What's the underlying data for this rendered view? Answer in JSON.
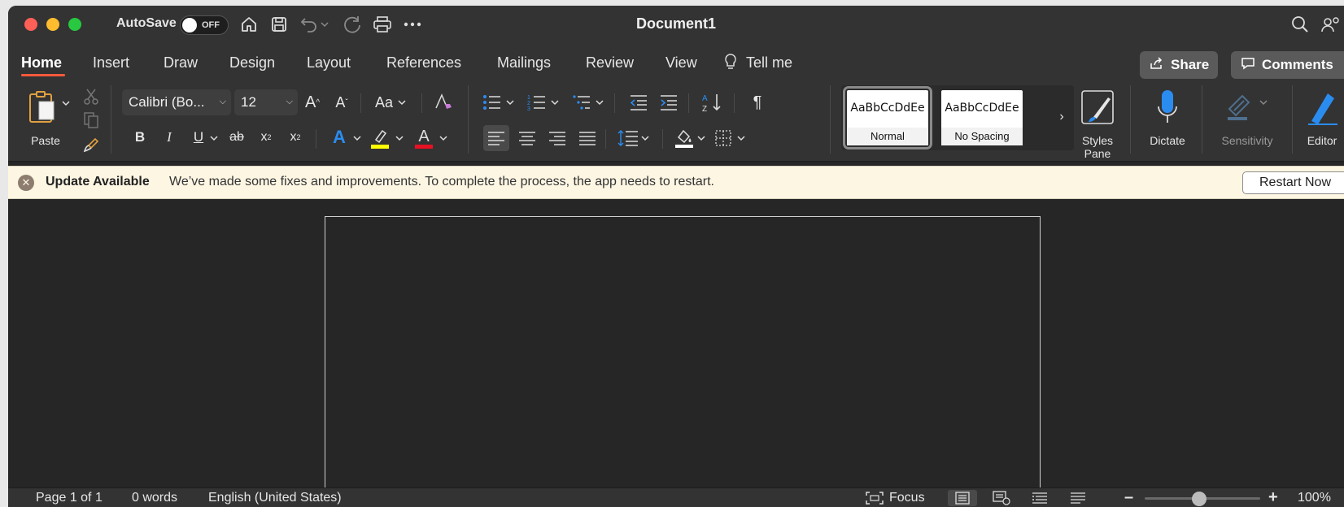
{
  "titlebar": {
    "autosave_label": "AutoSave",
    "autosave_state": "OFF",
    "title": "Document1"
  },
  "tabs": [
    {
      "label": "Home",
      "active": true
    },
    {
      "label": "Insert"
    },
    {
      "label": "Draw"
    },
    {
      "label": "Design"
    },
    {
      "label": "Layout"
    },
    {
      "label": "References"
    },
    {
      "label": "Mailings"
    },
    {
      "label": "Review"
    },
    {
      "label": "View"
    },
    {
      "label": "Tell me"
    }
  ],
  "actions": {
    "share_label": "Share",
    "comments_label": "Comments"
  },
  "ribbon": {
    "paste_label": "Paste",
    "font_name": "Calibri (Bo...",
    "font_size": "12",
    "change_case_label": "Aa",
    "styles": [
      {
        "preview": "AaBbCcDdEe",
        "name": "Normal",
        "selected": true
      },
      {
        "preview": "AaBbCcDdEe",
        "name": "No Spacing"
      }
    ],
    "styles_pane_label_1": "Styles",
    "styles_pane_label_2": "Pane",
    "dictate_label": "Dictate",
    "sensitivity_label": "Sensitivity",
    "editor_label": "Editor"
  },
  "notification": {
    "title": "Update Available",
    "message": "We’ve made some fixes and improvements. To complete the process, the app needs to restart.",
    "button": "Restart Now"
  },
  "status": {
    "page": "Page 1 of 1",
    "words": "0 words",
    "language": "English (United States)",
    "focus_label": "Focus",
    "zoom": "100%",
    "zoom_fraction": 0.47
  },
  "colors": {
    "accent_underline": "#ff5a3c",
    "highlight": "#ffff00",
    "font_color": "#e81123",
    "notify_bg": "#fdf6e3"
  }
}
